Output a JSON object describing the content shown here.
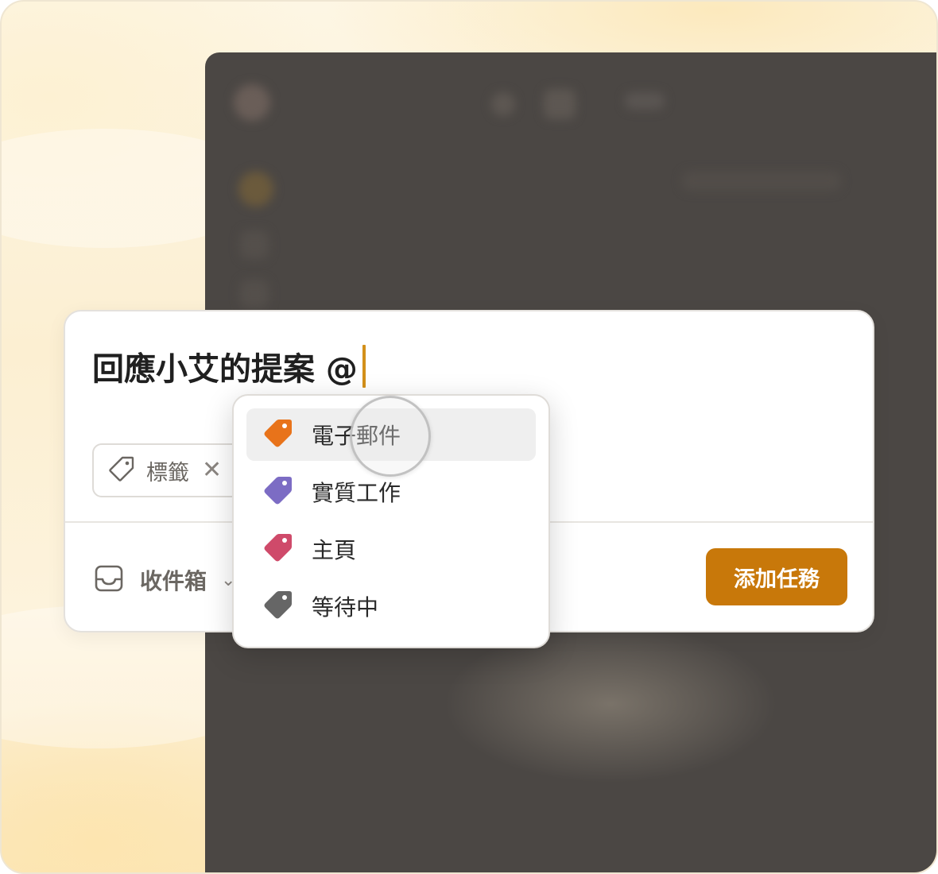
{
  "task": {
    "title": "回應小艾的提案 @"
  },
  "label_chip": {
    "label": "標籤",
    "remove_glyph": "✕",
    "icon": "tag-outline-icon"
  },
  "project_select": {
    "label": "收件箱",
    "icon": "inbox-icon",
    "chevron": "⌄"
  },
  "add_button": {
    "label": "添加任務",
    "color": "#c8780a"
  },
  "label_menu": {
    "items": [
      {
        "label": "電子郵件",
        "color": "#e8731a",
        "icon": "tag-icon",
        "active": true
      },
      {
        "label": "實質工作",
        "color": "#7c6cc4",
        "icon": "tag-icon",
        "active": false
      },
      {
        "label": "主頁",
        "color": "#cf4a6a",
        "icon": "tag-icon",
        "active": false
      },
      {
        "label": "等待中",
        "color": "#666666",
        "icon": "tag-icon",
        "active": false
      }
    ]
  },
  "colors": {
    "caret": "#d3901a",
    "background_panel": "#4b4744"
  }
}
